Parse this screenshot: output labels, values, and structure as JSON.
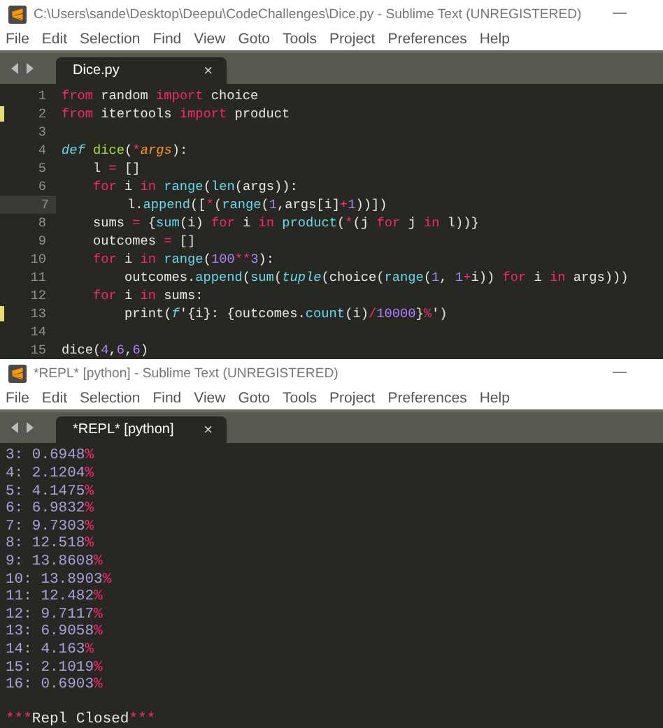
{
  "windows": [
    {
      "title": "C:\\Users\\sande\\Desktop\\Deepu\\CodeChallenges\\Dice.py - Sublime Text (UNREGISTERED)",
      "menu": [
        "File",
        "Edit",
        "Selection",
        "Find",
        "View",
        "Goto",
        "Tools",
        "Project",
        "Preferences",
        "Help"
      ],
      "tabs": [
        {
          "label": "Dice.py",
          "close": "×",
          "selected": true
        }
      ],
      "kind": "editor",
      "lines": [
        {
          "number": "1",
          "modified": false,
          "current": false,
          "tokens": [
            {
              "kind": "keyword",
              "text": "from"
            },
            {
              "kind": "plain",
              "text": " random "
            },
            {
              "kind": "keyword",
              "text": "import"
            },
            {
              "kind": "plain",
              "text": " choice"
            }
          ]
        },
        {
          "number": "2",
          "modified": true,
          "current": false,
          "tokens": [
            {
              "kind": "keyword",
              "text": "from"
            },
            {
              "kind": "plain",
              "text": " itertools "
            },
            {
              "kind": "keyword",
              "text": "import"
            },
            {
              "kind": "plain",
              "text": " product"
            }
          ]
        },
        {
          "number": "3",
          "modified": false,
          "current": false
        },
        {
          "number": "4",
          "modified": false,
          "current": false,
          "tokens": [
            {
              "kind": "storage",
              "text": "def "
            },
            {
              "kind": "function",
              "text": "dice"
            },
            {
              "kind": "plain",
              "text": "("
            },
            {
              "kind": "operator",
              "text": "*"
            },
            {
              "kind": "parameter",
              "text": "args"
            },
            {
              "kind": "plain",
              "text": "):"
            }
          ]
        },
        {
          "number": "5",
          "modified": false,
          "current": false,
          "tokens": [
            {
              "kind": "plain",
              "text": "    l "
            },
            {
              "kind": "operator",
              "text": "="
            },
            {
              "kind": "plain",
              "text": " []"
            }
          ]
        },
        {
          "number": "6",
          "modified": false,
          "current": false,
          "tokens": [
            {
              "kind": "keyword",
              "text": "    for"
            },
            {
              "kind": "plain",
              "text": " i "
            },
            {
              "kind": "keyword",
              "text": "in "
            },
            {
              "kind": "builtin",
              "text": "range"
            },
            {
              "kind": "plain",
              "text": "("
            },
            {
              "kind": "builtin",
              "text": "len"
            },
            {
              "kind": "plain",
              "text": "(args)):"
            }
          ]
        },
        {
          "number": "7",
          "modified": false,
          "current": true,
          "tokens": [
            {
              "kind": "plain",
              "text": "        l."
            },
            {
              "kind": "builtin",
              "text": "append"
            },
            {
              "kind": "plain",
              "text": "(["
            },
            {
              "kind": "operator",
              "text": "*"
            },
            {
              "kind": "plain",
              "text": "("
            },
            {
              "kind": "builtin",
              "text": "range"
            },
            {
              "kind": "plain",
              "text": "("
            },
            {
              "kind": "number",
              "text": "1"
            },
            {
              "kind": "plain",
              "text": ",args[i]"
            },
            {
              "kind": "operator",
              "text": "+"
            },
            {
              "kind": "number",
              "text": "1"
            },
            {
              "kind": "plain",
              "text": "))])"
            }
          ]
        },
        {
          "number": "8",
          "modified": false,
          "current": false,
          "tokens": [
            {
              "kind": "plain",
              "text": "    sums "
            },
            {
              "kind": "operator",
              "text": "="
            },
            {
              "kind": "plain",
              "text": " {"
            },
            {
              "kind": "builtin",
              "text": "sum"
            },
            {
              "kind": "plain",
              "text": "(i) "
            },
            {
              "kind": "keyword",
              "text": "for"
            },
            {
              "kind": "plain",
              "text": " i "
            },
            {
              "kind": "keyword",
              "text": "in "
            },
            {
              "kind": "builtin",
              "text": "product"
            },
            {
              "kind": "plain",
              "text": "("
            },
            {
              "kind": "operator",
              "text": "*"
            },
            {
              "kind": "plain",
              "text": "(j "
            },
            {
              "kind": "keyword",
              "text": "for"
            },
            {
              "kind": "plain",
              "text": " j "
            },
            {
              "kind": "keyword",
              "text": "in"
            },
            {
              "kind": "plain",
              "text": " l))}"
            }
          ]
        },
        {
          "number": "9",
          "modified": false,
          "current": false,
          "tokens": [
            {
              "kind": "plain",
              "text": "    outcomes "
            },
            {
              "kind": "operator",
              "text": "="
            },
            {
              "kind": "plain",
              "text": " []"
            }
          ]
        },
        {
          "number": "10",
          "modified": false,
          "current": false,
          "tokens": [
            {
              "kind": "keyword",
              "text": "    for"
            },
            {
              "kind": "plain",
              "text": " i "
            },
            {
              "kind": "keyword",
              "text": "in "
            },
            {
              "kind": "builtin",
              "text": "range"
            },
            {
              "kind": "plain",
              "text": "("
            },
            {
              "kind": "number",
              "text": "100"
            },
            {
              "kind": "operator",
              "text": "**"
            },
            {
              "kind": "number",
              "text": "3"
            },
            {
              "kind": "plain",
              "text": "):"
            }
          ]
        },
        {
          "number": "11",
          "modified": false,
          "current": false,
          "tokens": [
            {
              "kind": "plain",
              "text": "        outcomes."
            },
            {
              "kind": "builtin",
              "text": "append"
            },
            {
              "kind": "plain",
              "text": "("
            },
            {
              "kind": "builtin",
              "text": "sum"
            },
            {
              "kind": "plain",
              "text": "("
            },
            {
              "kind": "type",
              "text": "tuple"
            },
            {
              "kind": "plain",
              "text": "(choice("
            },
            {
              "kind": "builtin",
              "text": "range"
            },
            {
              "kind": "plain",
              "text": "("
            },
            {
              "kind": "number",
              "text": "1"
            },
            {
              "kind": "plain",
              "text": ", "
            },
            {
              "kind": "number",
              "text": "1"
            },
            {
              "kind": "operator",
              "text": "+"
            },
            {
              "kind": "plain",
              "text": "i)) "
            },
            {
              "kind": "keyword",
              "text": "for"
            },
            {
              "kind": "plain",
              "text": " i "
            },
            {
              "kind": "keyword",
              "text": "in"
            },
            {
              "kind": "plain",
              "text": " args)))"
            }
          ]
        },
        {
          "number": "12",
          "modified": false,
          "current": false,
          "tokens": [
            {
              "kind": "keyword",
              "text": "    for"
            },
            {
              "kind": "plain",
              "text": " i "
            },
            {
              "kind": "keyword",
              "text": "in"
            },
            {
              "kind": "plain",
              "text": " sums:"
            }
          ]
        },
        {
          "number": "13",
          "modified": true,
          "current": false,
          "tokens": [
            {
              "kind": "plain",
              "text": "        print("
            },
            {
              "kind": "storage",
              "text": "f"
            },
            {
              "kind": "plain",
              "text": "'{i}: {outcomes."
            },
            {
              "kind": "builtin",
              "text": "count"
            },
            {
              "kind": "plain",
              "text": "(i)"
            },
            {
              "kind": "operator",
              "text": "/"
            },
            {
              "kind": "number",
              "text": "10000"
            },
            {
              "kind": "plain",
              "text": "}"
            },
            {
              "kind": "operator",
              "text": "%"
            },
            {
              "kind": "plain",
              "text": "')"
            }
          ]
        },
        {
          "number": "14",
          "modified": false,
          "current": false
        },
        {
          "number": "15",
          "modified": false,
          "current": false,
          "tokens": [
            {
              "kind": "plain",
              "text": "dice("
            },
            {
              "kind": "number",
              "text": "4"
            },
            {
              "kind": "plain",
              "text": ","
            },
            {
              "kind": "number",
              "text": "6"
            },
            {
              "kind": "plain",
              "text": ","
            },
            {
              "kind": "number",
              "text": "6"
            },
            {
              "kind": "plain",
              "text": ")"
            }
          ]
        }
      ]
    },
    {
      "title": "*REPL* [python] - Sublime Text (UNREGISTERED)",
      "menu": [
        "File",
        "Edit",
        "Selection",
        "Find",
        "View",
        "Goto",
        "Tools",
        "Project",
        "Preferences",
        "Help"
      ],
      "tabs": [
        {
          "label": "*REPL* [python]",
          "close": "×",
          "selected": true
        }
      ],
      "kind": "repl",
      "output": [
        {
          "text": "3: 0.6948",
          "suffix": "%"
        },
        {
          "text": "4: 2.1204",
          "suffix": "%"
        },
        {
          "text": "5: 4.1475",
          "suffix": "%"
        },
        {
          "text": "6: 6.9832",
          "suffix": "%"
        },
        {
          "text": "7: 9.7303",
          "suffix": "%"
        },
        {
          "text": "8: 12.518",
          "suffix": "%"
        },
        {
          "text": "9: 13.8608",
          "suffix": "%"
        },
        {
          "text": "10: 13.8903",
          "suffix": "%"
        },
        {
          "text": "11: 12.482",
          "suffix": "%"
        },
        {
          "text": "12: 9.7117",
          "suffix": "%"
        },
        {
          "text": "13: 6.9058",
          "suffix": "%"
        },
        {
          "text": "14: 4.163",
          "suffix": "%"
        },
        {
          "text": "15: 2.1019",
          "suffix": "%"
        },
        {
          "text": "16: 0.6903",
          "suffix": "%"
        }
      ],
      "closed": {
        "prefix": "***",
        "text": "Repl Closed",
        "suffix": "***"
      }
    }
  ]
}
